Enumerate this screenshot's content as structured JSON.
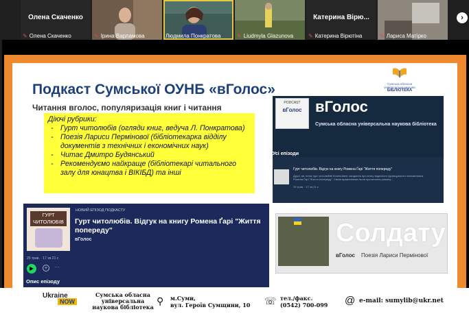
{
  "participants": [
    {
      "label": "Олена Скаченко",
      "big": "Олена Скаченко"
    },
    {
      "label": "Ірина Варламова",
      "big": ""
    },
    {
      "label": "Людмила Понкратова",
      "big": ""
    },
    {
      "label": "Liudmyla Glazunova",
      "big": ""
    },
    {
      "label": "Катерина Вірютіна",
      "big": "Катерина Вірю..."
    },
    {
      "label": "Лариса Матірко",
      "big": ""
    }
  ],
  "icons": {
    "next": "chevron-right-icon",
    "mic": "muted-mic-icon"
  },
  "slide": {
    "title": "Подкаст Сумської ОУНБ «вГолос»",
    "subtitle": "Читання вголос, популяризація книг і читання",
    "rubrics_heading": "Діючі рубрики:",
    "rubrics": [
      "Гурт читолюбів (огляди книг, ведуча Л. Понкратова)",
      "Поезія Лариси Пермінової (бібліотекарка відділу документів з технічних і економічних наук)",
      "Читає Дмитро Будянський",
      "Рекомендуємо найкраще (бібліотекарі читального залу для юнацтва і ВІКІБД) та інші"
    ],
    "logo": {
      "line1": "Сумська обласна",
      "line2": "універсальна наукова",
      "line3": "БІБЛІОТЕКА"
    }
  },
  "podcast_panel": {
    "cover_label": "PODCAST",
    "cover_name": "вГолос",
    "name": "вГолос",
    "org": "Сумська обласна універсальна наукова бібліотека",
    "episodes_heading": "Усі епізоди",
    "episode_title": "Гурт читолюбів. Відгук на книгу Ромена Ґарі \"Життя попереду\"",
    "episode_desc": "Друзі, ви, вітає гурт читолюбів! Колективне засідання про книгу видатного французького письменника Ромена Ґарі \"Життя попереду\". Своїм враженнями після прочитання роману...",
    "episode_meta": "29 трав. · 17 хв 21 с"
  },
  "episode_card": {
    "cover_label": "ГУРТ ЧИТОЛЮБІВ",
    "tag": "НОВИЙ ЕПІЗОД ПОДКАСТУ",
    "title": "Гурт читолюбів. Відгук на книгу Ромена Ґарі \"Життя попереду\"",
    "author": "вГолос",
    "meta": "29 трав. · 17 хв 21 с",
    "description_heading": "Опис епізоду"
  },
  "soldier": {
    "word": "Солдату",
    "brand": "вГолос",
    "caption": "Поезія Лариси Пермінової"
  },
  "footer": {
    "ukraine": "Ukraine",
    "now": "NOW",
    "library": "Сумська обласна універсальна наукова бібліотека",
    "address": "м.Суми,\nвул. Героїв Сумщини, 10",
    "phone": "тел./факс.\n(0542) 700-099",
    "email": "e-mail: sumylib@ukr.net"
  }
}
